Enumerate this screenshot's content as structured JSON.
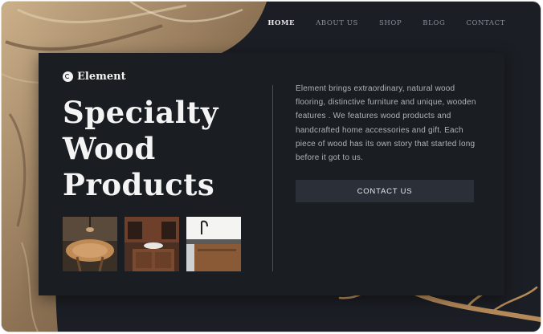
{
  "nav": {
    "items": [
      "HOME",
      "ABOUT US",
      "SHOP",
      "BLOG",
      "CONTACT"
    ],
    "active": "HOME"
  },
  "brand": {
    "name": "Element"
  },
  "hero": {
    "title_lines": [
      "Specialty",
      "Wood",
      "Products"
    ],
    "description": "Element brings extraordinary, natural wood flooring, distinctive furniture and unique, wooden features . We features wood products and handcrafted home accessories and gift. Each piece of wood has its own story that started long before it got to us.",
    "cta_label": "CONTACT US"
  },
  "colors": {
    "background": "#1b1e24",
    "card": "#1a1d22",
    "button": "#2a2f38",
    "wood": "#a88460"
  },
  "images": [
    "wood-table-photo",
    "bathroom-vanity-photo",
    "kitchen-sink-photo"
  ]
}
